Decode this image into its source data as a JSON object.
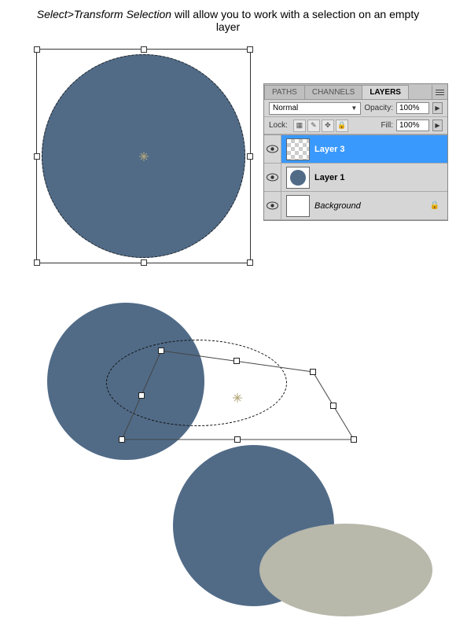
{
  "caption": {
    "emphasis": "Select>Transform Selection",
    "rest": " will allow you to work with a selection on an empty layer"
  },
  "panel": {
    "tabs": {
      "paths": "PATHS",
      "channels": "CHANNELS",
      "layers": "LAYERS"
    },
    "blend_mode": "Normal",
    "opacity_label": "Opacity:",
    "opacity_value": "100%",
    "lock_label": "Lock:",
    "fill_label": "Fill:",
    "fill_value": "100%",
    "layers": [
      {
        "name": "Layer 3"
      },
      {
        "name": "Layer 1"
      },
      {
        "name": "Background"
      }
    ]
  }
}
